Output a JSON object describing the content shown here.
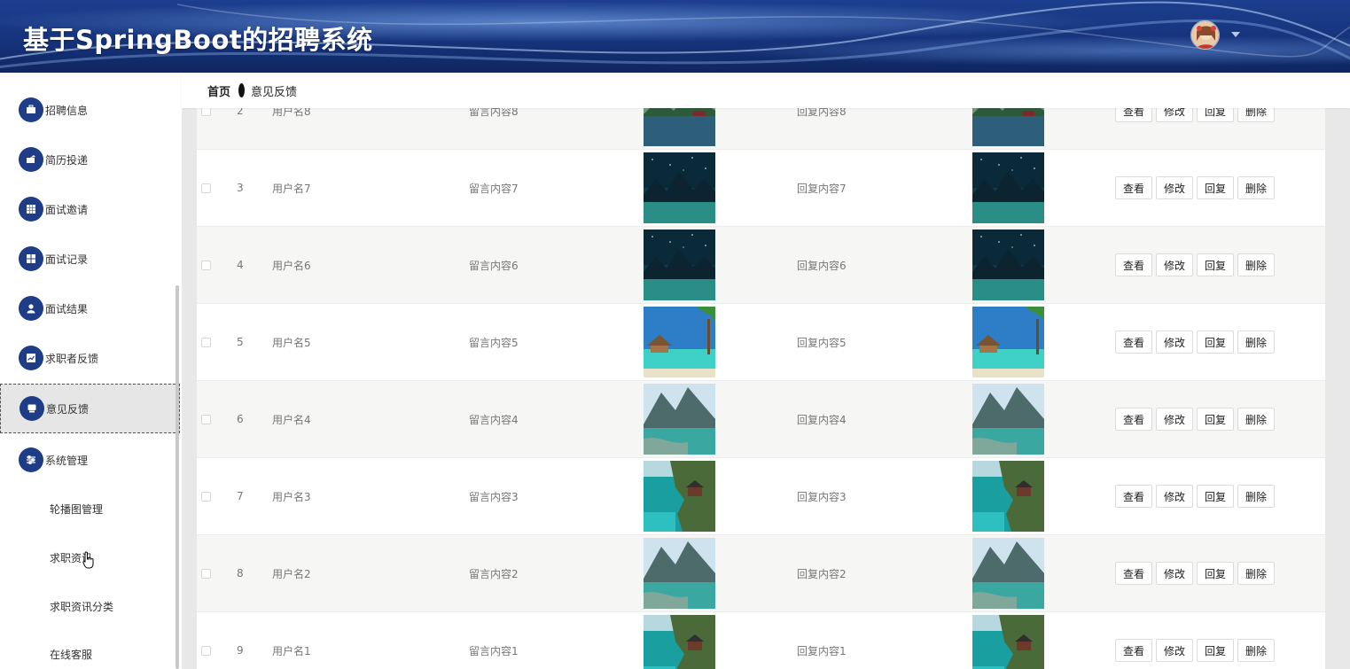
{
  "header": {
    "title": "基于SpringBoot的招聘系统",
    "avatar_icon": "avatar",
    "caret_icon": "caret-down-icon"
  },
  "breadcrumb": {
    "home": "首页",
    "current": "意见反馈"
  },
  "sidebar": {
    "items": [
      {
        "label": "招聘信息",
        "icon": "briefcase-icon"
      },
      {
        "label": "简历投递",
        "icon": "send-icon"
      },
      {
        "label": "面试邀请",
        "icon": "grid-icon"
      },
      {
        "label": "面试记录",
        "icon": "apps-icon"
      },
      {
        "label": "面试结果",
        "icon": "user-icon"
      },
      {
        "label": "求职者反馈",
        "icon": "chart-icon"
      },
      {
        "label": "意见反馈",
        "icon": "chat-icon",
        "active": true
      },
      {
        "label": "系统管理",
        "icon": "sliders-icon"
      }
    ],
    "subitems": [
      "轮播图管理",
      "求职资讯",
      "求职资讯分类",
      "在线客服"
    ]
  },
  "table": {
    "actions": [
      "查看",
      "修改",
      "回复",
      "删除"
    ],
    "rows": [
      {
        "index": "2",
        "user": "用户名8",
        "message": "留言内容8",
        "reply": "回复内容8",
        "image": "lake"
      },
      {
        "index": "3",
        "user": "用户名7",
        "message": "留言内容7",
        "reply": "回复内容7",
        "image": "night"
      },
      {
        "index": "4",
        "user": "用户名6",
        "message": "留言内容6",
        "reply": "回复内容6",
        "image": "night"
      },
      {
        "index": "5",
        "user": "用户名5",
        "message": "留言内容5",
        "reply": "回复内容5",
        "image": "beach"
      },
      {
        "index": "6",
        "user": "用户名4",
        "message": "留言内容4",
        "reply": "回复内容4",
        "image": "mountain"
      },
      {
        "index": "7",
        "user": "用户名3",
        "message": "留言内容3",
        "reply": "回复内容3",
        "image": "cliff"
      },
      {
        "index": "8",
        "user": "用户名2",
        "message": "留言内容2",
        "reply": "回复内容2",
        "image": "mountain"
      },
      {
        "index": "9",
        "user": "用户名1",
        "message": "留言内容1",
        "reply": "回复内容1",
        "image": "cliff"
      }
    ]
  },
  "colors": {
    "header_bg": "#16337c",
    "menu_icon_bg": "#1e3d86",
    "row_alt_bg": "#f6f6f4"
  }
}
